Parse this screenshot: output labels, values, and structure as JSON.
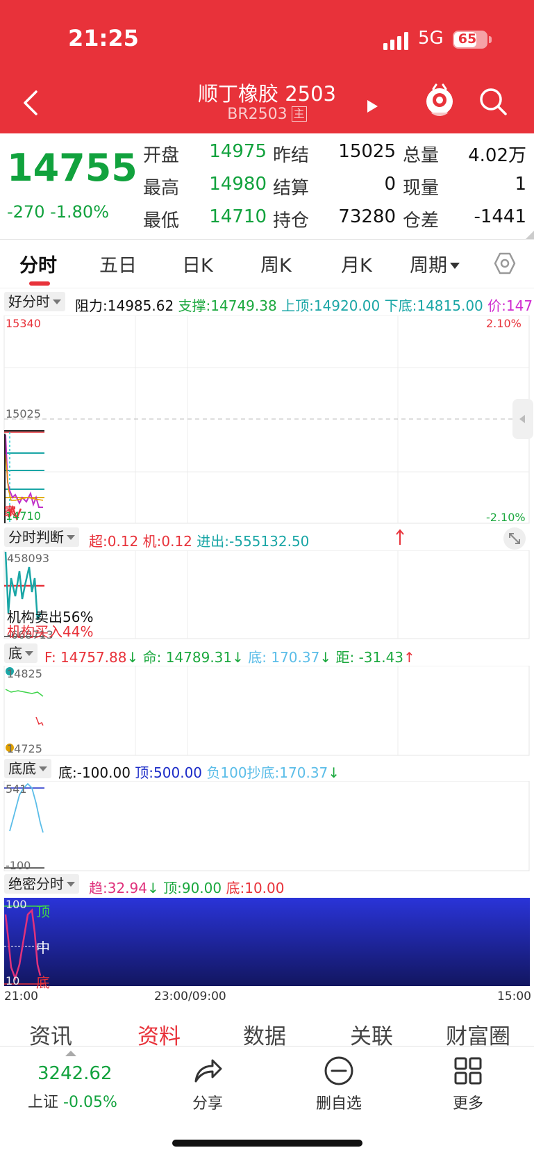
{
  "status_bar": {
    "time": "21:25",
    "network": "5G",
    "battery": "65"
  },
  "header": {
    "title": "顺丁橡胶 2503",
    "code": "BR2503",
    "main_tag": "主"
  },
  "quote": {
    "price": "14755",
    "change": "-270  -1.80%",
    "rows": [
      {
        "l1": "开盘",
        "v1": "14975",
        "l2": "昨结",
        "v2": "15025",
        "l3": "总量",
        "v3": "4.02万"
      },
      {
        "l1": "最高",
        "v1": "14980",
        "l2": "结算",
        "v2": "0",
        "l3": "现量",
        "v3": "1"
      },
      {
        "l1": "最低",
        "v1": "14710",
        "l2": "持仓",
        "v2": "73280",
        "l3": "仓差",
        "v3": "-1441"
      }
    ]
  },
  "tabs": [
    "分时",
    "五日",
    "日K",
    "周K",
    "月K",
    "周期"
  ],
  "panel1": {
    "selector": "好分时",
    "resist_label": "阻力:",
    "resist": "14985.62",
    "support": "支撑:14749.38",
    "top": "上顶:14920.00",
    "bottom": "下底:14815.00",
    "price": "价:147",
    "y_top": "15340",
    "y_mid": "15025",
    "y_bot": "14710",
    "pct_top": "2.10%",
    "pct_bot": "-2.10%"
  },
  "panel2": {
    "selector": "分时判断",
    "chao": "超:0.12",
    "ji": "机:0.12",
    "jinchu": "进出:-555132.50",
    "y_top": "458093",
    "y_bot": "-668713",
    "sell": "机构卖出56%",
    "buy": "机构买入44%"
  },
  "panel3": {
    "selector": "底",
    "f": "F: 14757.88",
    "ming": "命: 14789.31",
    "di": "底: 170.37",
    "ju": "距: -31.43",
    "y_top": "14825",
    "y_bot": "14725"
  },
  "panel4": {
    "selector": "底底",
    "di": "底:-100.00",
    "ding": "顶:500.00",
    "chaodi": "负100抄底:170.37",
    "y_top": "541",
    "y_bot": "-100"
  },
  "panel5": {
    "selector": "绝密分时",
    "qu": "趋:32.94",
    "ding": "顶:90.00",
    "di": "底:10.00",
    "y_top": "100",
    "y_bot": "10",
    "mark_top": "顶",
    "mark_mid": "中",
    "mark_bot": "底"
  },
  "time_axis": [
    "21:00",
    "23:00/09:00",
    "15:00"
  ],
  "bottom_tabs": [
    "资讯",
    "资料",
    "数据",
    "关联",
    "财富圈"
  ],
  "index": {
    "value": "3242.62",
    "name": "上证",
    "change": "-0.05%"
  },
  "actions": [
    "分享",
    "删自选",
    "更多"
  ],
  "colors": {
    "header": "#E8323A",
    "down": "#11A23D",
    "up": "#E8323A",
    "panel5_bg": "#1A1F9E"
  },
  "icons": [
    "back-icon",
    "play-icon",
    "mascot-icon",
    "search-icon",
    "settings-icon",
    "expand-icon",
    "share-icon",
    "minus-circle-icon",
    "grid-icon"
  ]
}
